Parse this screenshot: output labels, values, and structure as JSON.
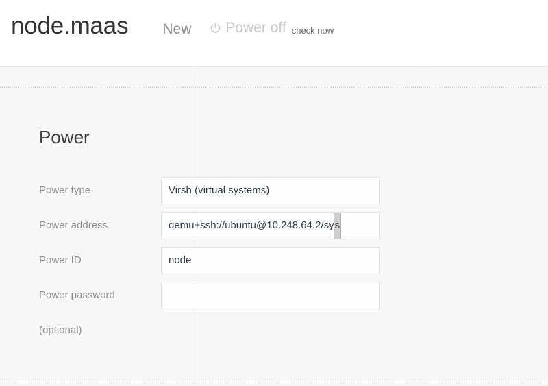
{
  "header": {
    "node_title": "node.maas",
    "status": "New",
    "power_icon": "power-icon",
    "power_state": "Power off",
    "check_now": "check now"
  },
  "main": {
    "section_title": "Power",
    "fields": [
      {
        "name": "power-type",
        "label": "Power type",
        "sub_label": "",
        "value": "Virsh (virtual systems)",
        "placeholder": ""
      },
      {
        "name": "power-address",
        "label": "Power address",
        "sub_label": "",
        "value": "qemu+ssh://ubuntu@10.248.64.2/sy",
        "selected_char": "s",
        "placeholder": ""
      },
      {
        "name": "power-id",
        "label": "Power ID",
        "sub_label": "",
        "value": "node",
        "placeholder": ""
      },
      {
        "name": "power-password",
        "label": "Power password",
        "sub_label": "(optional)",
        "value": "",
        "placeholder": ""
      }
    ]
  },
  "colors": {
    "page_background": "#f7f7f7",
    "header_background": "#ffffff",
    "title_text": "#333333",
    "label_text": "#8f8f93",
    "value_text": "#2f3c4c",
    "muted_text": "#c8c8c8",
    "field_border": "#e2e2e2",
    "rule": "#c9c9c9"
  }
}
